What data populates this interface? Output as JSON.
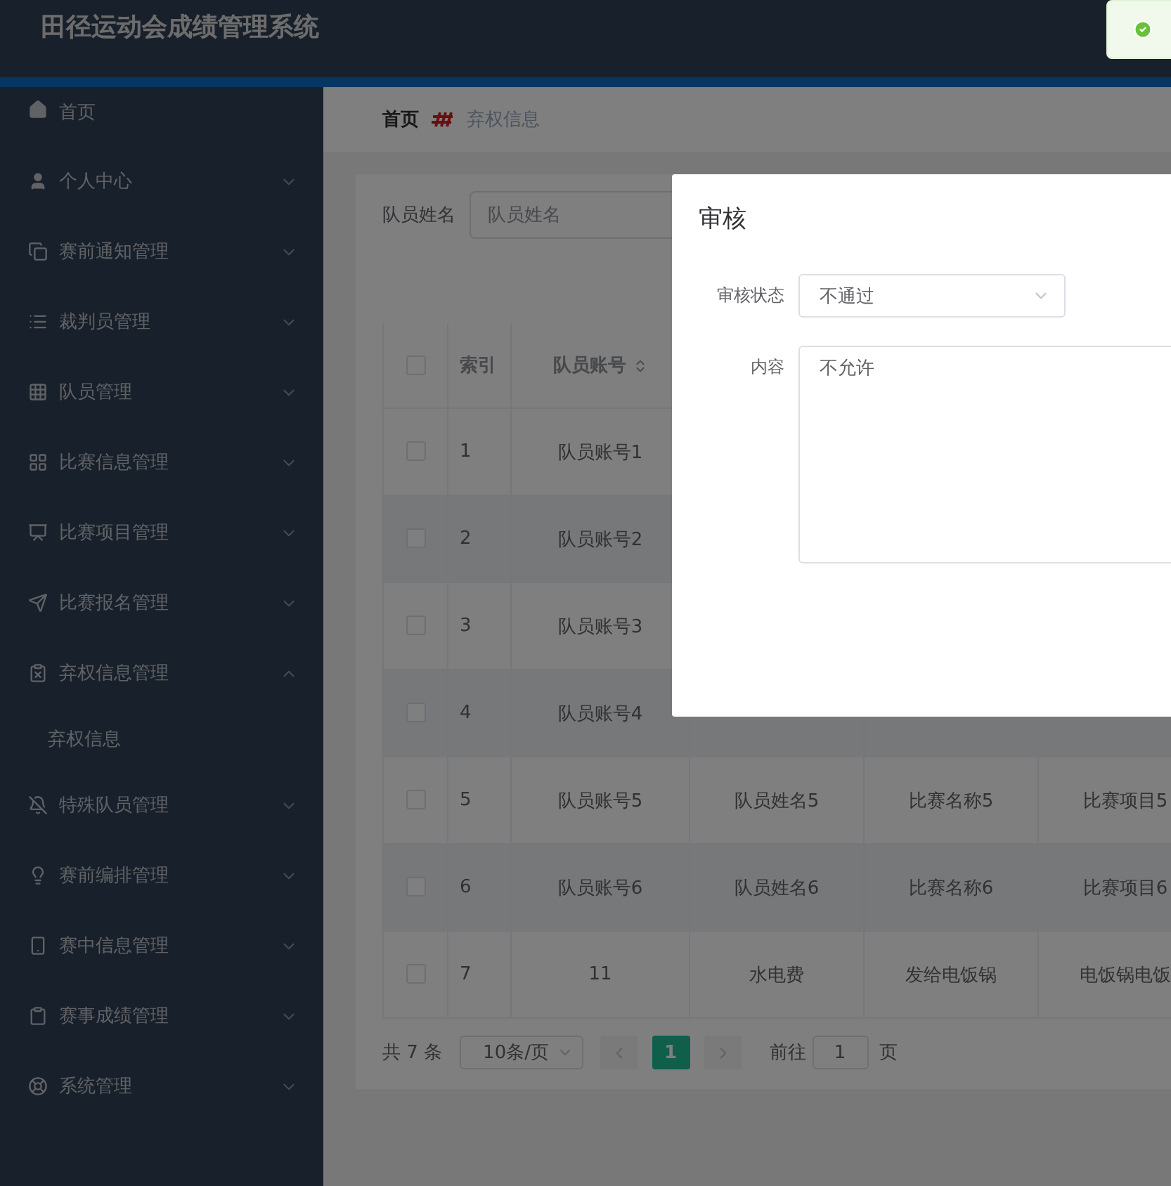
{
  "header": {
    "title": "田径运动会成绩管理系统"
  },
  "toast": {
    "kind": "success"
  },
  "sidebar": {
    "items": [
      {
        "label": "首页",
        "kind": "link"
      },
      {
        "label": "个人中心",
        "kind": "submenu",
        "expanded": false
      },
      {
        "label": "赛前通知管理",
        "kind": "submenu",
        "expanded": false
      },
      {
        "label": "裁判员管理",
        "kind": "submenu",
        "expanded": false
      },
      {
        "label": "队员管理",
        "kind": "submenu",
        "expanded": false
      },
      {
        "label": "比赛信息管理",
        "kind": "submenu",
        "expanded": false
      },
      {
        "label": "比赛项目管理",
        "kind": "submenu",
        "expanded": false
      },
      {
        "label": "比赛报名管理",
        "kind": "submenu",
        "expanded": false
      },
      {
        "label": "弃权信息管理",
        "kind": "submenu",
        "expanded": true,
        "children": [
          {
            "label": "弃权信息"
          }
        ]
      },
      {
        "label": "特殊队员管理",
        "kind": "submenu",
        "expanded": false
      },
      {
        "label": "赛前编排管理",
        "kind": "submenu",
        "expanded": false
      },
      {
        "label": "赛中信息管理",
        "kind": "submenu",
        "expanded": false
      },
      {
        "label": "赛事成绩管理",
        "kind": "submenu",
        "expanded": false
      },
      {
        "label": "系统管理",
        "kind": "submenu",
        "expanded": false
      }
    ]
  },
  "breadcrumb": [
    {
      "label": "首页",
      "current": false
    },
    {
      "label": "弃权信息",
      "current": true
    }
  ],
  "search": {
    "label": "队员姓名",
    "placeholder": "队员姓名"
  },
  "table": {
    "select_all_checked": false,
    "columns": [
      {
        "label": "索引",
        "sortable": false
      },
      {
        "label": "队员账号",
        "sortable": true
      }
    ],
    "rows": [
      {
        "checked": false,
        "cells": [
          "1",
          "队员账号1"
        ]
      },
      {
        "checked": false,
        "cells": [
          "2",
          "队员账号2"
        ]
      },
      {
        "checked": false,
        "cells": [
          "3",
          "队员账号3"
        ]
      },
      {
        "checked": false,
        "cells": [
          "4",
          "队员账号4"
        ]
      },
      {
        "checked": false,
        "cells": [
          "5",
          "队员账号5",
          "队员姓名5",
          "比赛名称5",
          "比赛项目5"
        ]
      },
      {
        "checked": false,
        "cells": [
          "6",
          "队员账号6",
          "队员姓名6",
          "比赛名称6",
          "比赛项目6"
        ]
      },
      {
        "checked": false,
        "cells": [
          "7",
          "11",
          "水电费",
          "发给电饭锅",
          "电饭锅电饭"
        ]
      }
    ]
  },
  "pagination": {
    "total": "共 7 条",
    "page_size": "10条/页",
    "pages": [
      {
        "label": "1",
        "selected": true
      }
    ],
    "goto_label": "前往",
    "goto_value": "1",
    "goto_suffix": "页"
  },
  "dialog": {
    "title": "审核",
    "fields": [
      {
        "label": "审核状态",
        "kind": "select",
        "value": "不通过"
      },
      {
        "label": "内容",
        "kind": "textarea",
        "value": "不允许"
      }
    ]
  }
}
